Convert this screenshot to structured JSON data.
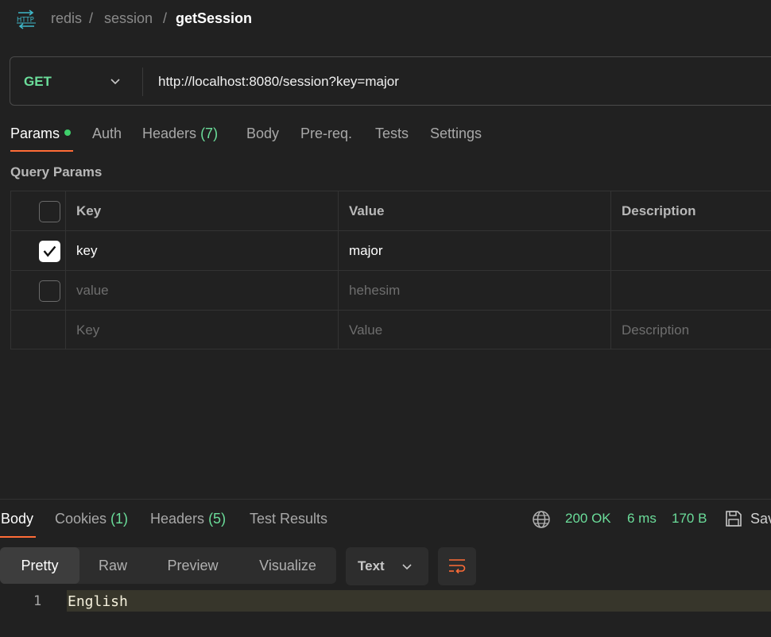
{
  "breadcrumb": {
    "items": [
      "redis",
      "session"
    ],
    "separator": "/",
    "current": "getSession",
    "icon": "http-icon"
  },
  "request": {
    "method": "GET",
    "url": "http://localhost:8080/session?key=major"
  },
  "request_tabs": [
    {
      "label": "Params",
      "active": true,
      "dot": true
    },
    {
      "label": "Auth"
    },
    {
      "label": "Headers",
      "count": "(7)"
    },
    {
      "label": "Body"
    },
    {
      "label": "Pre-req."
    },
    {
      "label": "Tests"
    },
    {
      "label": "Settings"
    }
  ],
  "query_params": {
    "title": "Query Params",
    "columns": [
      "Key",
      "Value",
      "Description"
    ],
    "rows": [
      {
        "checked": true,
        "key": "key",
        "value": "major",
        "description": ""
      },
      {
        "checked": false,
        "key": "value",
        "value": "hehesim",
        "description": ""
      }
    ],
    "placeholder": {
      "key": "Key",
      "value": "Value",
      "description": "Description"
    }
  },
  "response": {
    "tabs": [
      {
        "label": "Body",
        "active": true
      },
      {
        "label": "Cookies",
        "count": "(1)"
      },
      {
        "label": "Headers",
        "count": "(5)"
      },
      {
        "label": "Test Results"
      }
    ],
    "status": "200 OK",
    "time": "6 ms",
    "size": "170 B",
    "save_label": "Sav",
    "view_modes": [
      "Pretty",
      "Raw",
      "Preview",
      "Visualize"
    ],
    "active_view": "Pretty",
    "format": "Text",
    "body_lines": [
      {
        "no": "1",
        "text": "English"
      }
    ]
  },
  "colors": {
    "accent": "#ff6c37",
    "success": "#6bdd9a",
    "background": "#212121"
  }
}
